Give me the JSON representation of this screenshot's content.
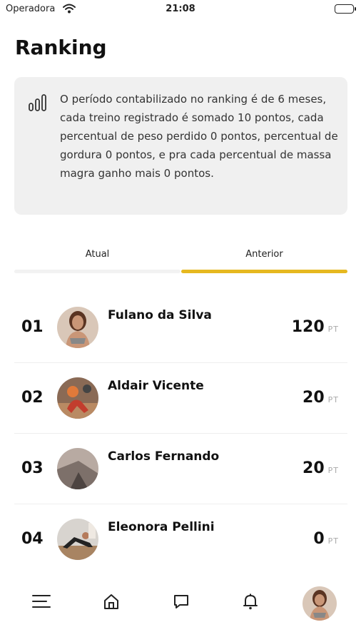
{
  "status_bar": {
    "carrier": "Operadora",
    "time": "21:08"
  },
  "page": {
    "title": "Ranking"
  },
  "info_card": {
    "icon": "bar-chart-icon",
    "text": "O período contabilizado no ranking é de 6 meses, cada treino registrado é somado 10 pontos, cada percentual de peso perdido 0 pontos, percentual de gordura 0 pontos, e pra cada percentual de massa magra ganho mais 0 pontos."
  },
  "tabs": {
    "items": [
      {
        "label": "Atual",
        "active": false
      },
      {
        "label": "Anterior",
        "active": true
      }
    ],
    "accent_color": "#e6b820"
  },
  "ranking": {
    "unit": "PT",
    "rows": [
      {
        "position": "01",
        "name": "Fulano da Silva",
        "score": "120"
      },
      {
        "position": "02",
        "name": "Aldair Vicente",
        "score": "20"
      },
      {
        "position": "03",
        "name": "Carlos Fernando",
        "score": "20"
      },
      {
        "position": "04",
        "name": "Eleonora Pellini",
        "score": "0"
      }
    ]
  },
  "bottom_nav": {
    "items": [
      "menu-icon",
      "home-icon",
      "chat-icon",
      "bell-icon",
      "profile-avatar"
    ]
  }
}
